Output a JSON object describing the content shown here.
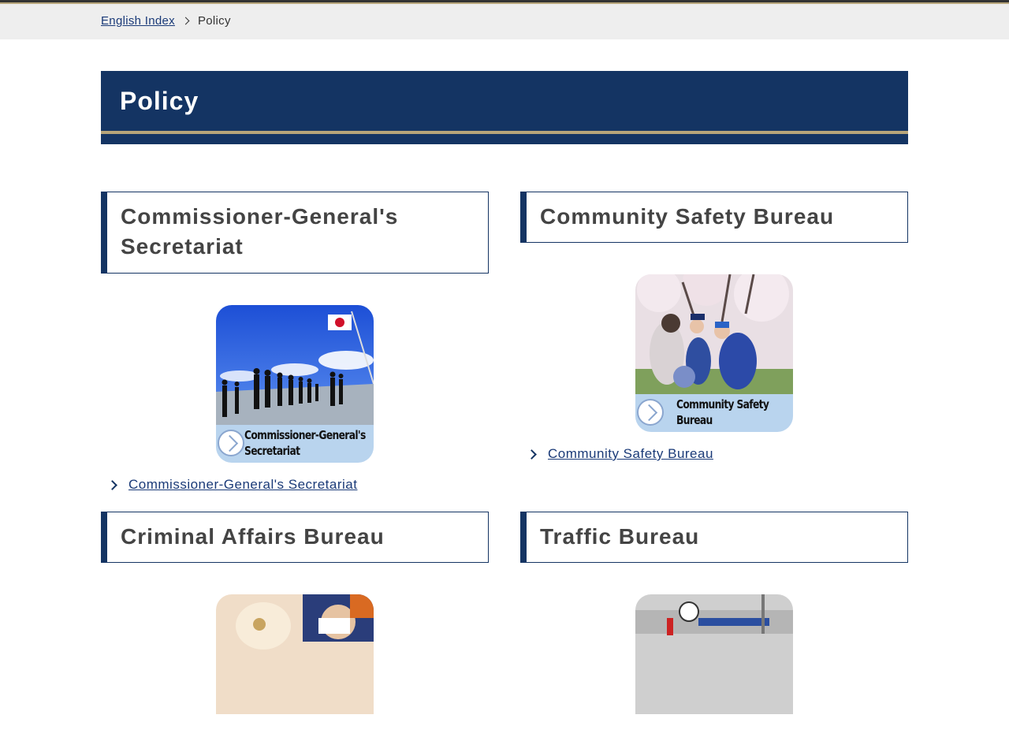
{
  "breadcrumb": {
    "home_label": "English Index",
    "current_label": "Policy"
  },
  "page": {
    "title": "Policy"
  },
  "sections": [
    {
      "heading": "Commissioner-General's Secretariat",
      "banner_text": "Commissioner-General's Secretariat",
      "link_label": "Commissioner-General's Secretariat"
    },
    {
      "heading": "Community Safety Bureau",
      "banner_text": "Community Safety Bureau",
      "link_label": "Community Safety Bureau"
    },
    {
      "heading": "Criminal Affairs Bureau"
    },
    {
      "heading": "Traffic Bureau"
    }
  ],
  "colors": {
    "navy": "#143463",
    "gold": "#b7a57a",
    "link": "#1a3a78",
    "banner": "#b9d4ee"
  }
}
